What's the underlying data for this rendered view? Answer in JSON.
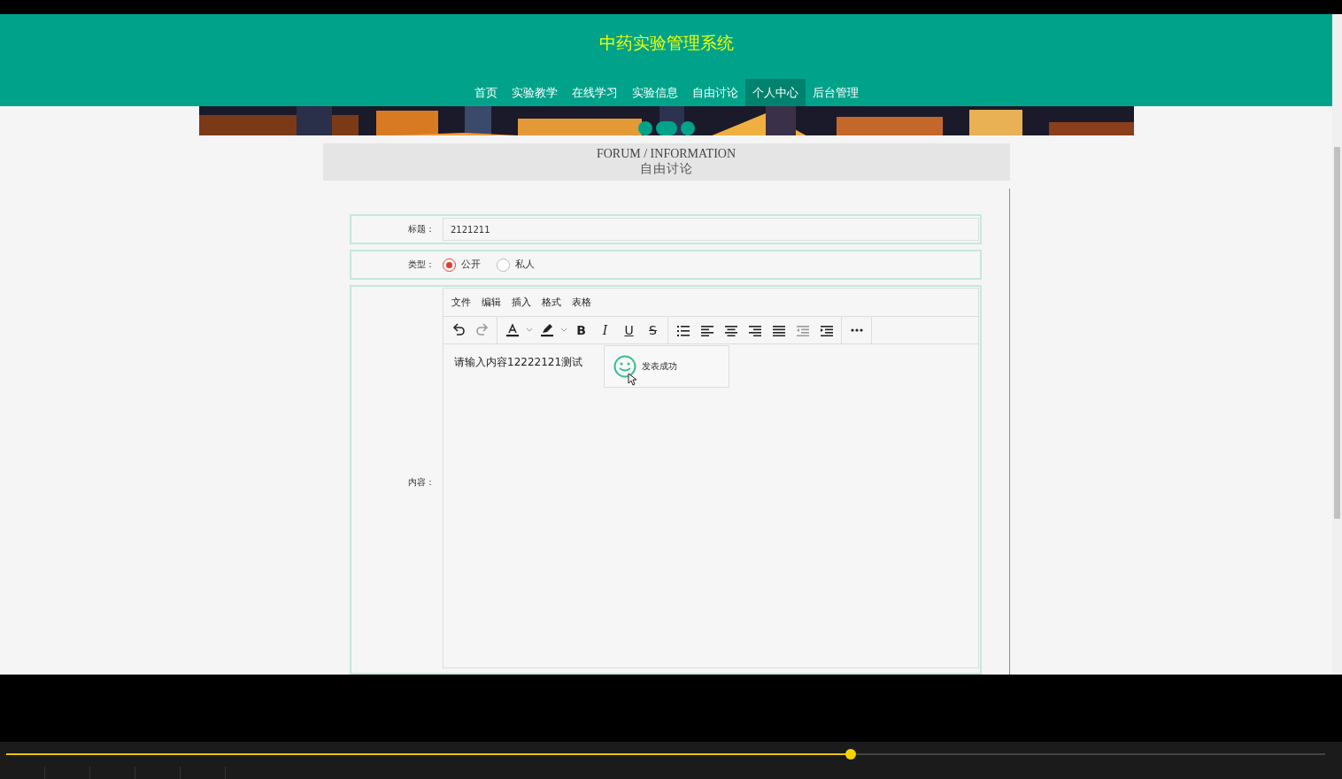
{
  "site": {
    "title": "中药实验管理系统",
    "nav": [
      {
        "label": "首页",
        "selected": false
      },
      {
        "label": "实验教学",
        "selected": false
      },
      {
        "label": "在线学习",
        "selected": false
      },
      {
        "label": "实验信息",
        "selected": false
      },
      {
        "label": "自由讨论",
        "selected": false
      },
      {
        "label": "个人中心",
        "selected": true
      },
      {
        "label": "后台管理",
        "selected": false
      }
    ]
  },
  "banner": {
    "kind": "picture",
    "slides": [
      {
        "selected": false
      },
      {
        "selected": true
      },
      {
        "selected": false
      }
    ]
  },
  "heading": {
    "english": "FORUM / INFORMATION",
    "chinese": "自由讨论"
  },
  "form": {
    "title_label": "标题：",
    "title_value": "2121211",
    "type_label": "类型：",
    "type_options": [
      {
        "label": "公开",
        "selected": true
      },
      {
        "label": "私人",
        "selected": false
      }
    ],
    "content_label": "内容："
  },
  "editor": {
    "menu": [
      "文件",
      "编辑",
      "插入",
      "格式",
      "表格"
    ],
    "toolbar": [
      [
        {
          "kind": "undo"
        },
        {
          "kind": "redo"
        }
      ],
      [
        {
          "kind": "text-color"
        },
        {
          "kind": "caret"
        },
        {
          "kind": "highlight"
        },
        {
          "kind": "caret"
        },
        {
          "kind": "bold",
          "label": "B"
        },
        {
          "kind": "italic",
          "label": "I"
        },
        {
          "kind": "underline",
          "label": "U"
        },
        {
          "kind": "strike",
          "label": "S"
        }
      ],
      [
        {
          "kind": "list"
        },
        {
          "kind": "align-left"
        },
        {
          "kind": "align-center"
        },
        {
          "kind": "align-right"
        },
        {
          "kind": "justify"
        },
        {
          "kind": "outdent"
        },
        {
          "kind": "indent"
        }
      ],
      [
        {
          "kind": "more"
        }
      ]
    ],
    "content": "请输入内容12222121测试"
  },
  "toast": {
    "message": "发表成功"
  },
  "player": {
    "level": 0.64
  }
}
